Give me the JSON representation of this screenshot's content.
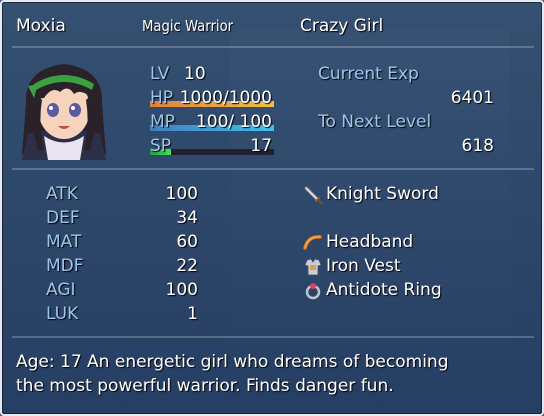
{
  "actor": {
    "name": "Moxia",
    "class": "Magic Warrior",
    "nickname": "Crazy Girl"
  },
  "basic": {
    "lv_label": "LV",
    "lv_value": "10",
    "hp_label": "HP",
    "hp_value": "1000/1000",
    "hp_rate": 1.0,
    "mp_label": "MP",
    "mp_value": "100/ 100",
    "mp_rate": 1.0,
    "sp_label": "SP",
    "sp_value": "17",
    "sp_rate": 0.17
  },
  "exp": {
    "current_label": "Current Exp",
    "current_value": "6401",
    "next_label": "To Next Level",
    "next_value": "618"
  },
  "params": [
    {
      "label": "ATK",
      "value": "100"
    },
    {
      "label": "DEF",
      "value": "34"
    },
    {
      "label": "MAT",
      "value": "60"
    },
    {
      "label": "MDF",
      "value": "22"
    },
    {
      "label": "AGI",
      "value": "100"
    },
    {
      "label": "LUK",
      "value": "1"
    }
  ],
  "equips": [
    {
      "name": "Knight Sword",
      "icon": "sword-icon"
    },
    {
      "name": "",
      "icon": ""
    },
    {
      "name": "Headband",
      "icon": "headband-icon"
    },
    {
      "name": "Iron Vest",
      "icon": "armor-icon"
    },
    {
      "name": "Antidote Ring",
      "icon": "ring-icon"
    }
  ],
  "profile": {
    "line1": "Age: 17 An energetic girl who dreams of becoming",
    "line2": "the most powerful warrior. Finds danger fun."
  },
  "colors": {
    "system": "#9ec5ea",
    "hp_gauge_start": "#e08040",
    "hp_gauge_end": "#f0c040",
    "mp_gauge_start": "#4080c0",
    "mp_gauge_end": "#40c0f0",
    "sp_gauge": "#20c040"
  }
}
